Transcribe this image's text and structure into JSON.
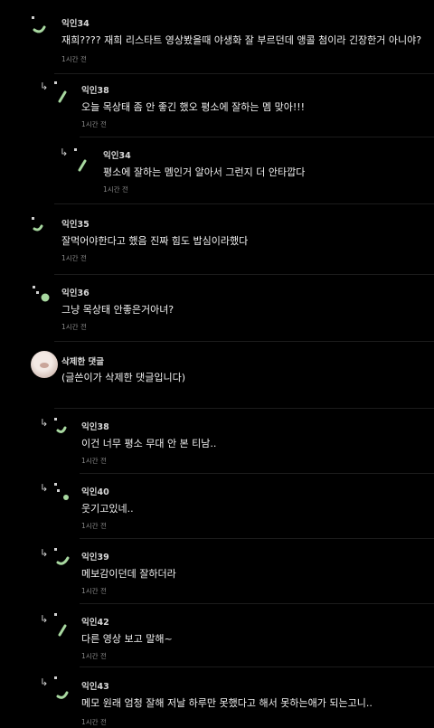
{
  "comments": [
    {
      "author": "익인34",
      "text": "재희???? 재희 리스타트 영상봤을때 야생화 잘 부르던데 앵콜 첨이라 긴장한거 아니야?",
      "time": "1시간 전"
    },
    {
      "reply_icon": "↳",
      "author": "익인38",
      "text": "오늘 목상태 좀 안 좋긴 했오 평소에 잘하는 멤 맞아!!!",
      "time": "1시간 전"
    },
    {
      "reply_icon": "↳",
      "author": "익인34",
      "text": "평소에 잘하는 멤인거 알아서 그런지 더 안타깝다",
      "time": "1시간 전"
    },
    {
      "author": "익인35",
      "text": "잘먹어야한다고 했음 진짜 힘도 밥심이라했다",
      "time": "1시간 전"
    },
    {
      "author": "익인36",
      "text": "그냥 목상태 안좋은거아녀?",
      "time": "1시간 전"
    },
    {
      "author": "삭제한 댓글",
      "text": "(글쓴이가 삭제한 댓글입니다)",
      "time": ""
    },
    {
      "reply_icon": "↳",
      "author": "익인38",
      "text": "이건 너무 평소 무대 안 본 티남..",
      "time": "1시간 전"
    },
    {
      "reply_icon": "↳",
      "author": "익인40",
      "text": "웃기고있네..",
      "time": "1시간 전"
    },
    {
      "reply_icon": "↳",
      "author": "익인39",
      "text": "메보감이던데 잘하더라",
      "time": "1시간 전"
    },
    {
      "reply_icon": "↳",
      "author": "익인42",
      "text": "다른 영상 보고 말해~",
      "time": "1시간 전"
    },
    {
      "reply_icon": "↳",
      "author": "익인43",
      "text": "메모 원래 엄청 잘해 저날 하루만 못했다고 해서 못하는애가 되는고니..",
      "time": "1시간 전"
    }
  ],
  "colors": {
    "background": "#000000",
    "avatar_accent": "#a8d8a0",
    "separator": "#1c1c1c"
  }
}
